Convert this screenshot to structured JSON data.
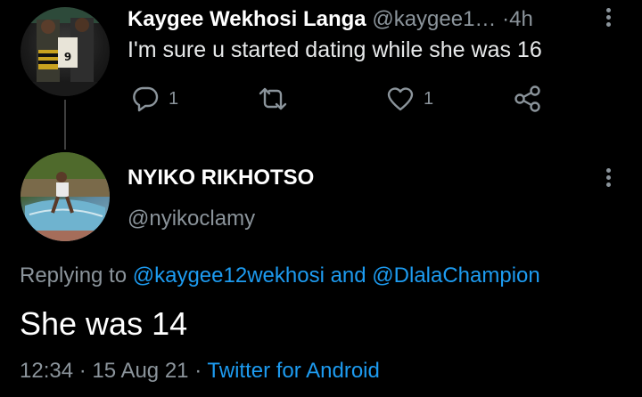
{
  "reply_parent": {
    "display_name": "Kaygee Wekhosi Langa",
    "handle": "@kaygee1…",
    "separator": "·",
    "time": "4h",
    "text": "I'm sure u started dating while she was 16",
    "actions": {
      "reply_count": "1",
      "retweet_count": "",
      "like_count": "1"
    },
    "avatar_jersey_number": "9"
  },
  "main_tweet": {
    "display_name": "NYIKO RIKHOTSO",
    "handle": "@nyikoclamy",
    "replying_prefix": "Replying to",
    "replying_user1": "@kaygee12wekhosi",
    "replying_and": "and",
    "replying_user2": "@DlalaChampion",
    "text": "She was 14",
    "time": "12:34",
    "sep1": "·",
    "date": "15 Aug 21",
    "sep2": "·",
    "source": "Twitter for Android"
  },
  "colors": {
    "background": "#000000",
    "primary_text": "#e7e9ea",
    "secondary_text": "#8b949b",
    "link": "#1d9bf0"
  },
  "icons": [
    "reply-icon",
    "retweet-icon",
    "like-icon",
    "share-icon",
    "more-vertical-icon"
  ]
}
